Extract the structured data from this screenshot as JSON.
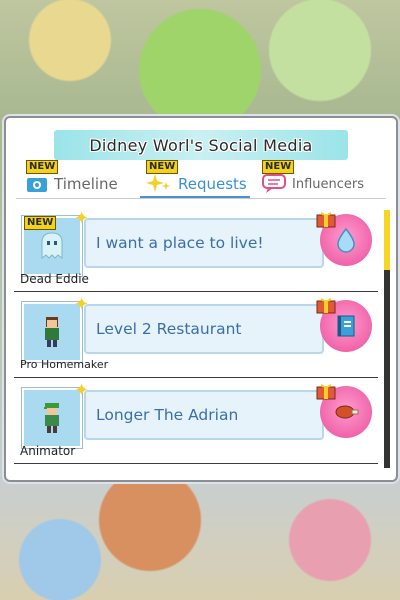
{
  "panel": {
    "title": "Didney Worl's Social Media"
  },
  "tabs": [
    {
      "label": "Timeline",
      "icon": "camera-icon",
      "new_badge": "NEW",
      "active": false
    },
    {
      "label": "Requests",
      "icon": "sparkle-icon",
      "new_badge": "NEW",
      "active": true
    },
    {
      "label": "Influencers",
      "icon": "speech-bubble-icon",
      "new_badge": "NEW",
      "active": false
    }
  ],
  "requests": [
    {
      "name": "Dead Eddie",
      "message": "I want a place to live!",
      "new_badge": "NEW",
      "avatar": "ghost-avatar",
      "reward": "water-drop-icon"
    },
    {
      "name": "Pro Homemaker",
      "message": "Level 2 Restaurant",
      "avatar": "person-avatar",
      "reward": "book-icon"
    },
    {
      "name": "Animator",
      "message": "Longer The Adrian",
      "avatar": "green-cap-person-avatar",
      "reward": "meat-icon"
    }
  ],
  "colors": {
    "title_bar": "#9be4e8",
    "active_tab": "#3a8fd8",
    "bubble": "#e6f3fb",
    "reward_circle": "#ea4e9a",
    "new_badge": "#f3d21a",
    "scroll_thumb": "#f7d524"
  }
}
